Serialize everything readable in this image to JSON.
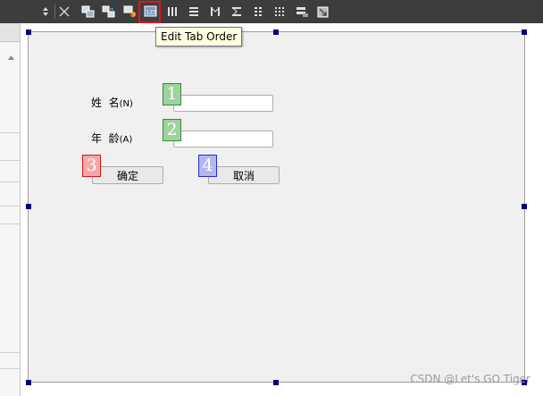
{
  "toolbar": {
    "tools": [
      {
        "icon": "spinbox-arrows-icon"
      },
      {
        "icon": "break-layout-icon"
      },
      {
        "icon": "edit-widgets-icon"
      },
      {
        "icon": "edit-signals-slots-icon"
      },
      {
        "icon": "edit-buddies-icon"
      },
      {
        "icon": "edit-tab-order-icon",
        "active": true
      },
      {
        "icon": "layout-horizontal-icon"
      },
      {
        "icon": "layout-vertical-icon"
      },
      {
        "icon": "layout-horizontal-splitter-icon"
      },
      {
        "icon": "layout-vertical-splitter-icon"
      },
      {
        "icon": "layout-form-icon"
      },
      {
        "icon": "layout-grid-icon"
      },
      {
        "icon": "break-layout-grid-icon"
      },
      {
        "icon": "adjust-size-icon"
      }
    ],
    "highlight_color": "#e8121c"
  },
  "tooltip": {
    "text": "Edit Tab Order"
  },
  "form": {
    "name_label": "姓  名",
    "name_mnemonic": "(N)",
    "age_label": "年  龄",
    "age_mnemonic": "(A)",
    "ok_button": "确定",
    "cancel_button": "取消",
    "tab_order": [
      {
        "number": "1",
        "target": "name-input",
        "color": "green"
      },
      {
        "number": "2",
        "target": "age-input",
        "color": "green"
      },
      {
        "number": "3",
        "target": "ok-button",
        "color": "red"
      },
      {
        "number": "4",
        "target": "cancel-button",
        "color": "blue"
      }
    ]
  },
  "watermark": "CSDN @Let's GO Tiger",
  "colors": {
    "toolbar_bg": "#3d3d3d",
    "form_bg": "#f0f0f0",
    "handle": "#00007f",
    "order_green": "#9ed29e",
    "order_red": "#f5a6a6",
    "order_blue": "#b6b6ee",
    "tooltip_bg": "#ffffe1"
  }
}
